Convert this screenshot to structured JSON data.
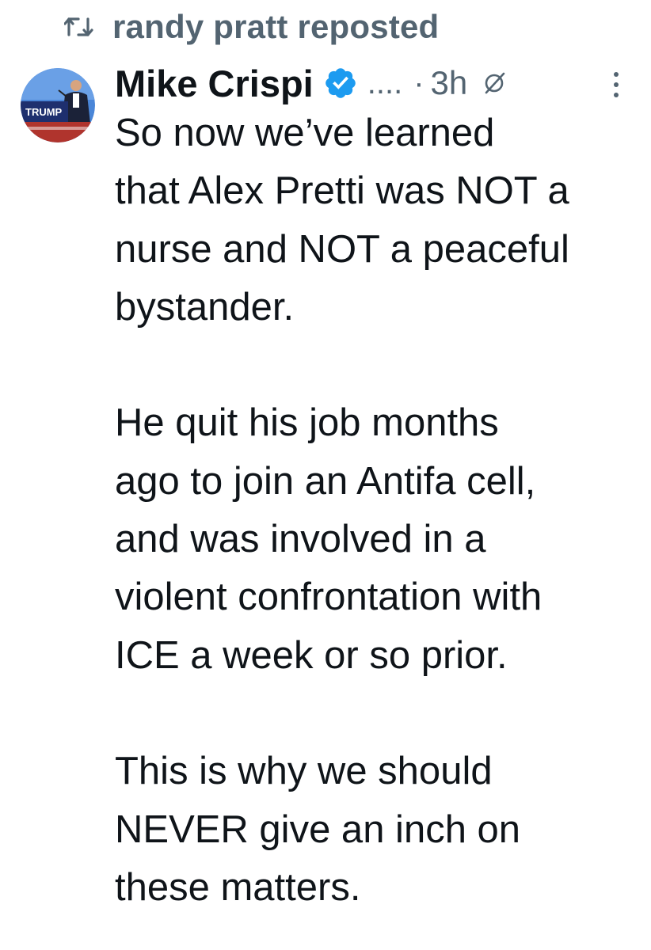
{
  "repost": {
    "icon": "repost-icon",
    "label": "randy pratt reposted"
  },
  "author": {
    "display_name": "Mike Crispi",
    "verified_icon": "verified-badge-icon",
    "handle": "....",
    "separator": "·",
    "timestamp": "3h",
    "grok_icon": "grok-slash-icon",
    "more_icon": "more-options-icon",
    "avatar": {
      "sign_text": "TRUMP",
      "colors": {
        "sky": "#4a86d8",
        "sign": "#1e2f6e",
        "sign_text": "#ffffff",
        "podium_red": "#b0342d"
      }
    }
  },
  "tweet": {
    "paragraphs": [
      {
        "lines": [
          "So now we’ve learned",
          "that Alex Pretti was NOT a",
          "nurse and NOT a peaceful",
          "bystander."
        ]
      },
      {
        "lines": [
          "He quit his job months",
          "ago to join an Antifa cell,",
          "and was involved in a",
          "violent confrontation with",
          "ICE a week or so prior."
        ]
      },
      {
        "lines": [
          "This is why we should",
          "NEVER give an inch on",
          "these matters."
        ]
      }
    ]
  },
  "colors": {
    "text_primary": "#0f1419",
    "text_secondary": "#536471",
    "verified_blue": "#1d9bf0",
    "background": "#ffffff"
  }
}
